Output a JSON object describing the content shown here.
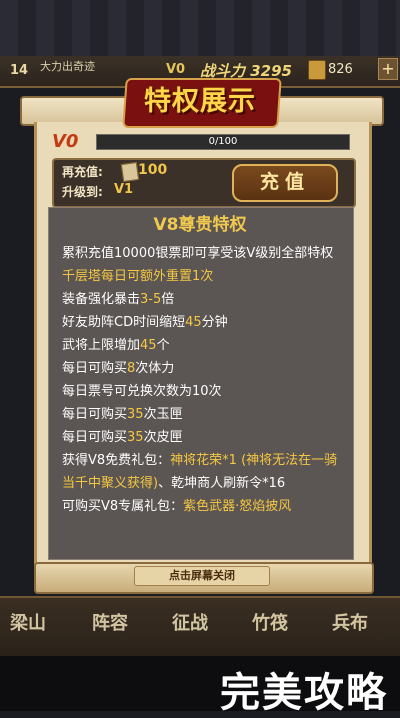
{
  "hud": {
    "level": "14",
    "name": "大力出奇迹",
    "vip": "V0",
    "power": "战斗力 3295",
    "coins": "826",
    "plus": "+"
  },
  "dialog": {
    "title": "特权展示",
    "vip_level": "V0",
    "progress_text": "0/100",
    "progress_fraction": 0,
    "recharge_label": "再充值:",
    "recharge_amount": "100",
    "upgrade_label": "升级到:",
    "upgrade_target": "V1",
    "recharge_button": "充值",
    "privilege_title": "V8尊贵特权",
    "close_hint": "点击屏幕关闭"
  },
  "privileges": [
    {
      "a": "累积充值10000银票即可享受该V级别全部特权",
      "b": "",
      "c": ""
    },
    {
      "a": "",
      "b": "千层塔每日可额外重置1次",
      "c": ""
    },
    {
      "a": "装备强化暴击",
      "b": "3-5",
      "c": "倍"
    },
    {
      "a": "好友助阵CD时间缩短",
      "b": "45",
      "c": "分钟"
    },
    {
      "a": "武将上限增加",
      "b": "45",
      "c": "个"
    },
    {
      "a": "每日可购买",
      "b": "8",
      "c": "次体力"
    },
    {
      "a": "每日票号可兑换次数为10次",
      "b": "",
      "c": ""
    },
    {
      "a": "每日可购买",
      "b": "35",
      "c": "次玉匣"
    },
    {
      "a": "每日可购买",
      "b": "35",
      "c": "次皮匣"
    },
    {
      "a": "获得V8免费礼包：",
      "b": "神将花荣*1 (神将无法在一骑当千中聚义获得)",
      "c": "、乾坤商人刷新令*16"
    },
    {
      "a": "可购买V8专属礼包：",
      "b": "紫色武器·怒焰披风",
      "c": ""
    }
  ],
  "nav": [
    "梁山",
    "阵容",
    "征战",
    "竹筏",
    "兵布"
  ],
  "watermark": "完美攻略",
  "colors": {
    "highlight": "#f5c842",
    "panel": "#e9dbb7",
    "title": "#ffd54a"
  }
}
